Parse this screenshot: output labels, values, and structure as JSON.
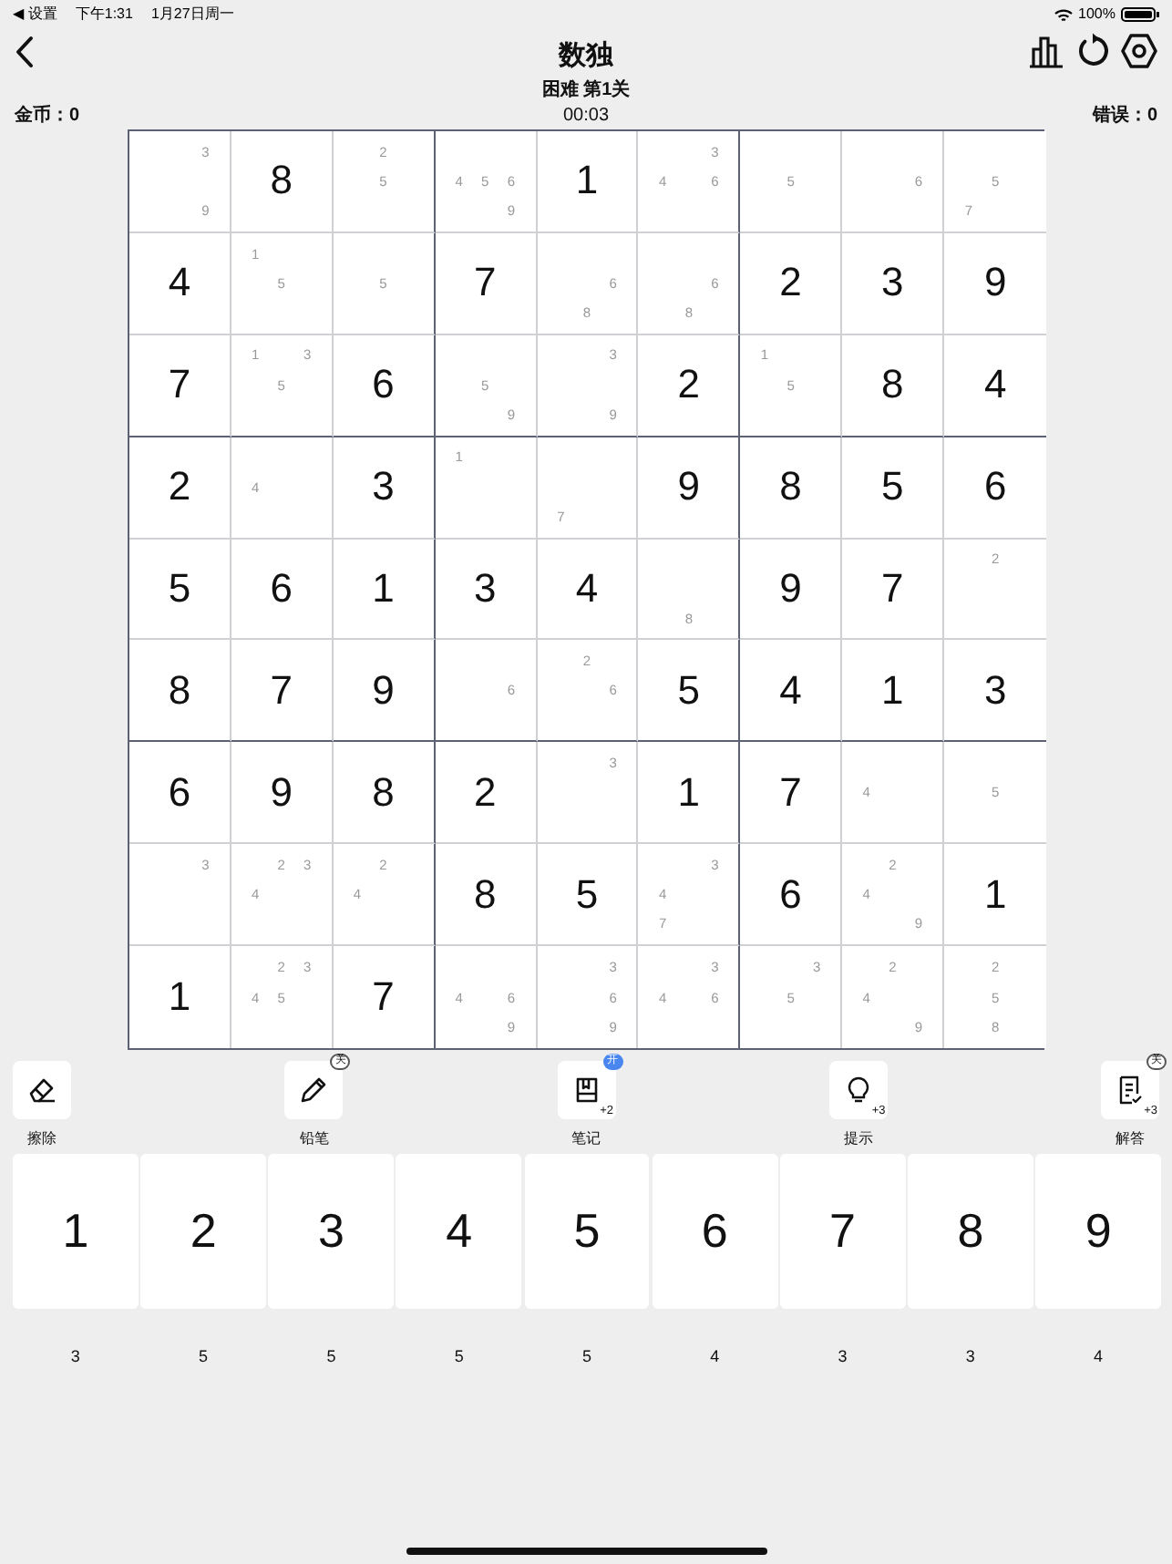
{
  "status_bar": {
    "back_app": "◀ 设置",
    "time": "下午1:31",
    "date": "1月27日周一",
    "battery": "100%"
  },
  "header": {
    "title": "数独",
    "subtitle": "困难 第1关",
    "timer": "00:03",
    "coins": "金币：0",
    "errors": "错误：0"
  },
  "board": [
    [
      {
        "notes": [
          {
            "digit": "3",
            "kind": "northeast"
          },
          {
            "digit": "9",
            "kind": "southeast"
          }
        ]
      },
      {
        "value": "8"
      },
      {
        "notes": [
          {
            "digit": "2",
            "kind": "north"
          },
          {
            "digit": "5",
            "kind": "center"
          }
        ]
      },
      {
        "notes": [
          {
            "digit": "4",
            "kind": "west"
          },
          {
            "digit": "5",
            "kind": "center"
          },
          {
            "digit": "6",
            "kind": "east"
          },
          {
            "digit": "9",
            "kind": "southeast"
          }
        ]
      },
      {
        "value": "1"
      },
      {
        "notes": [
          {
            "digit": "3",
            "kind": "northeast"
          },
          {
            "digit": "4",
            "kind": "west"
          },
          {
            "digit": "6",
            "kind": "east"
          }
        ]
      },
      {
        "notes": [
          {
            "digit": "5",
            "kind": "center"
          }
        ]
      },
      {
        "notes": [
          {
            "digit": "6",
            "kind": "east"
          }
        ]
      },
      {
        "notes": [
          {
            "digit": "5",
            "kind": "center"
          },
          {
            "digit": "7",
            "kind": "southwest"
          }
        ]
      }
    ],
    [
      {
        "value": "4"
      },
      {
        "notes": [
          {
            "digit": "1",
            "kind": "northwest"
          },
          {
            "digit": "5",
            "kind": "center"
          }
        ]
      },
      {
        "notes": [
          {
            "digit": "5",
            "kind": "center"
          }
        ]
      },
      {
        "value": "7"
      },
      {
        "notes": [
          {
            "digit": "6",
            "kind": "east"
          },
          {
            "digit": "8",
            "kind": "south"
          }
        ]
      },
      {
        "notes": [
          {
            "digit": "6",
            "kind": "east"
          },
          {
            "digit": "8",
            "kind": "south"
          }
        ]
      },
      {
        "value": "2"
      },
      {
        "value": "3"
      },
      {
        "value": "9"
      }
    ],
    [
      {
        "value": "7"
      },
      {
        "notes": [
          {
            "digit": "1",
            "kind": "northwest"
          },
          {
            "digit": "3",
            "kind": "northeast"
          },
          {
            "digit": "5",
            "kind": "center"
          }
        ]
      },
      {
        "value": "6"
      },
      {
        "notes": [
          {
            "digit": "5",
            "kind": "center"
          },
          {
            "digit": "9",
            "kind": "southeast"
          }
        ]
      },
      {
        "notes": [
          {
            "digit": "3",
            "kind": "northeast"
          },
          {
            "digit": "9",
            "kind": "southeast"
          }
        ]
      },
      {
        "value": "2"
      },
      {
        "notes": [
          {
            "digit": "1",
            "kind": "northwest"
          },
          {
            "digit": "5",
            "kind": "center"
          }
        ]
      },
      {
        "value": "8"
      },
      {
        "value": "4"
      }
    ],
    [
      {
        "value": "2"
      },
      {
        "notes": [
          {
            "digit": "4",
            "kind": "west"
          }
        ]
      },
      {
        "value": "3"
      },
      {
        "notes": [
          {
            "digit": "1",
            "kind": "northwest"
          }
        ]
      },
      {
        "notes": [
          {
            "digit": "7",
            "kind": "southwest"
          }
        ]
      },
      {
        "value": "9"
      },
      {
        "value": "8"
      },
      {
        "value": "5"
      },
      {
        "value": "6"
      }
    ],
    [
      {
        "value": "5"
      },
      {
        "value": "6"
      },
      {
        "value": "1"
      },
      {
        "value": "3"
      },
      {
        "value": "4"
      },
      {
        "notes": [
          {
            "digit": "8",
            "kind": "south"
          }
        ]
      },
      {
        "value": "9"
      },
      {
        "value": "7"
      },
      {
        "notes": [
          {
            "digit": "2",
            "kind": "north"
          }
        ]
      }
    ],
    [
      {
        "value": "8"
      },
      {
        "value": "7"
      },
      {
        "value": "9"
      },
      {
        "notes": [
          {
            "digit": "6",
            "kind": "east"
          }
        ]
      },
      {
        "notes": [
          {
            "digit": "2",
            "kind": "north"
          },
          {
            "digit": "6",
            "kind": "east"
          }
        ]
      },
      {
        "value": "5"
      },
      {
        "value": "4"
      },
      {
        "value": "1"
      },
      {
        "value": "3"
      }
    ],
    [
      {
        "value": "6"
      },
      {
        "value": "9"
      },
      {
        "value": "8"
      },
      {
        "value": "2"
      },
      {
        "notes": [
          {
            "digit": "3",
            "kind": "northeast"
          }
        ]
      },
      {
        "value": "1"
      },
      {
        "value": "7"
      },
      {
        "notes": [
          {
            "digit": "4",
            "kind": "west"
          }
        ]
      },
      {
        "notes": [
          {
            "digit": "5",
            "kind": "center"
          }
        ]
      }
    ],
    [
      {
        "notes": [
          {
            "digit": "3",
            "kind": "northeast"
          }
        ]
      },
      {
        "notes": [
          {
            "digit": "2",
            "kind": "north"
          },
          {
            "digit": "3",
            "kind": "northeast"
          },
          {
            "digit": "4",
            "kind": "west"
          }
        ]
      },
      {
        "notes": [
          {
            "digit": "2",
            "kind": "north"
          },
          {
            "digit": "4",
            "kind": "west"
          }
        ]
      },
      {
        "value": "8"
      },
      {
        "value": "5"
      },
      {
        "notes": [
          {
            "digit": "3",
            "kind": "northeast"
          },
          {
            "digit": "4",
            "kind": "west"
          },
          {
            "digit": "7",
            "kind": "southwest"
          }
        ]
      },
      {
        "value": "6"
      },
      {
        "notes": [
          {
            "digit": "2",
            "kind": "north"
          },
          {
            "digit": "4",
            "kind": "west"
          },
          {
            "digit": "9",
            "kind": "southeast"
          }
        ]
      },
      {
        "value": "1"
      }
    ],
    [
      {
        "value": "1"
      },
      {
        "notes": [
          {
            "digit": "2",
            "kind": "north"
          },
          {
            "digit": "3",
            "kind": "northeast"
          },
          {
            "digit": "4",
            "kind": "west"
          },
          {
            "digit": "5",
            "kind": "center"
          }
        ]
      },
      {
        "value": "7"
      },
      {
        "notes": [
          {
            "digit": "4",
            "kind": "west"
          },
          {
            "digit": "6",
            "kind": "east"
          },
          {
            "digit": "9",
            "kind": "southeast"
          }
        ]
      },
      {
        "notes": [
          {
            "digit": "3",
            "kind": "northeast"
          },
          {
            "digit": "6",
            "kind": "east"
          },
          {
            "digit": "9",
            "kind": "southeast"
          }
        ]
      },
      {
        "notes": [
          {
            "digit": "3",
            "kind": "northeast"
          },
          {
            "digit": "4",
            "kind": "west"
          },
          {
            "digit": "6",
            "kind": "east"
          }
        ]
      },
      {
        "notes": [
          {
            "digit": "3",
            "kind": "northeast"
          },
          {
            "digit": "5",
            "kind": "center"
          }
        ]
      },
      {
        "notes": [
          {
            "digit": "2",
            "kind": "north"
          },
          {
            "digit": "4",
            "kind": "west"
          },
          {
            "digit": "9",
            "kind": "southeast"
          }
        ]
      },
      {
        "notes": [
          {
            "digit": "2",
            "kind": "north"
          },
          {
            "digit": "5",
            "kind": "center"
          },
          {
            "digit": "8",
            "kind": "south"
          }
        ]
      }
    ]
  ],
  "tools": [
    {
      "kind": "eraser",
      "label": "擦除"
    },
    {
      "kind": "pencil",
      "label": "铅笔",
      "badge": {
        "text": "关",
        "on": false
      }
    },
    {
      "kind": "notebook",
      "label": "笔记",
      "badge": {
        "text": "开",
        "on": true
      },
      "count": "+2"
    },
    {
      "kind": "bulb",
      "label": "提示",
      "count": "+3"
    },
    {
      "kind": "answer",
      "label": "解答",
      "badge": {
        "text": "关",
        "on": false
      },
      "count": "+3"
    }
  ],
  "keypad": [
    {
      "digit": "1",
      "remaining": "3"
    },
    {
      "digit": "2",
      "remaining": "5"
    },
    {
      "digit": "3",
      "remaining": "5"
    },
    {
      "digit": "4",
      "remaining": "5"
    },
    {
      "digit": "5",
      "remaining": "5"
    },
    {
      "digit": "6",
      "remaining": "4"
    },
    {
      "digit": "7",
      "remaining": "3"
    },
    {
      "digit": "8",
      "remaining": "3"
    },
    {
      "digit": "9",
      "remaining": "4"
    }
  ]
}
